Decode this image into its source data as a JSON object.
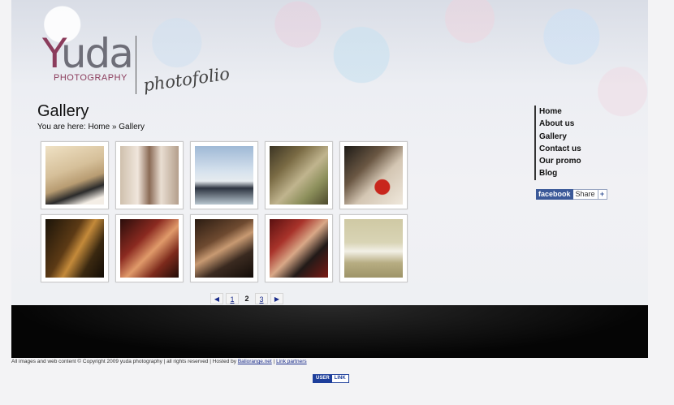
{
  "logo": {
    "word": "YUDA",
    "sub": "PHOTOGRAPHY",
    "script": "photofolio"
  },
  "page_title": "Gallery",
  "breadcrumb": {
    "prefix": "You are here:",
    "home": "Home",
    "separator": "»",
    "current": "Gallery"
  },
  "nav": {
    "items": [
      "Home",
      "About us",
      "Gallery",
      "Contact us",
      "Our promo",
      "Blog"
    ]
  },
  "share": {
    "brand": "facebook",
    "label": "Share",
    "plus": "+"
  },
  "pagination": {
    "prev": "◀",
    "pages": [
      "1",
      "2",
      "3"
    ],
    "current": "2",
    "next": "▶"
  },
  "footer": {
    "text": "All images and web content © Copyright 2009 yuda photography | all rights reserved | Hosted by",
    "host_link": "Baliorange.net",
    "sep": "|",
    "partners_link": "Link partners"
  },
  "userlink": {
    "left": "USER",
    "right": "LINK"
  }
}
